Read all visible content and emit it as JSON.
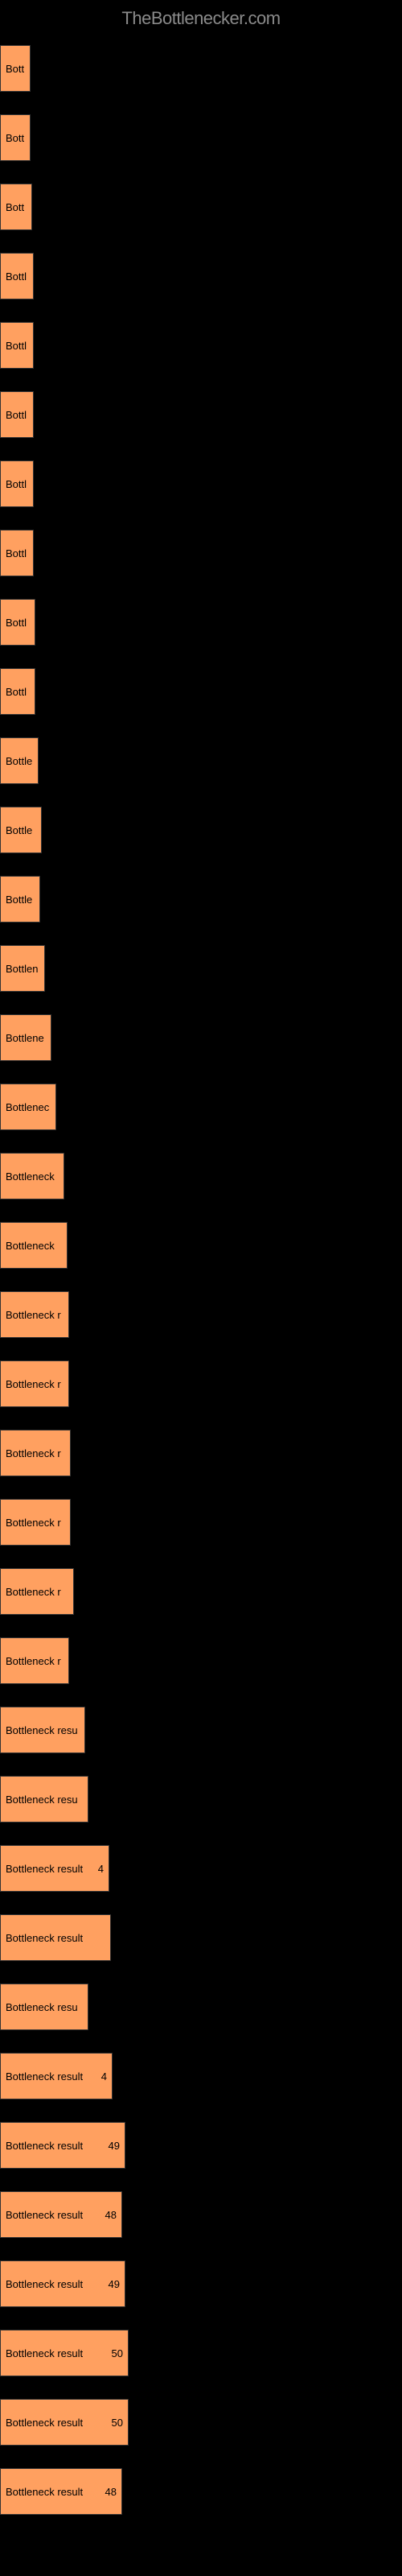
{
  "header": {
    "site_name": "TheBottlenecker.com"
  },
  "chart_data": {
    "type": "bar",
    "title": "",
    "xlabel": "",
    "ylabel": "",
    "max_width": 500,
    "bars": [
      {
        "label": "Bottleneck result",
        "width": 38,
        "value_shown": ""
      },
      {
        "label": "Bottleneck result",
        "width": 38,
        "value_shown": ""
      },
      {
        "label": "Bottleneck result",
        "width": 40,
        "value_shown": ""
      },
      {
        "label": "Bottleneck result",
        "width": 42,
        "value_shown": ""
      },
      {
        "label": "Bottleneck result",
        "width": 42,
        "value_shown": ""
      },
      {
        "label": "Bottleneck result",
        "width": 42,
        "value_shown": ""
      },
      {
        "label": "Bottleneck result",
        "width": 42,
        "value_shown": ""
      },
      {
        "label": "Bottleneck result",
        "width": 42,
        "value_shown": ""
      },
      {
        "label": "Bottleneck result",
        "width": 44,
        "value_shown": ""
      },
      {
        "label": "Bottleneck result",
        "width": 44,
        "value_shown": ""
      },
      {
        "label": "Bottleneck result",
        "width": 48,
        "value_shown": ""
      },
      {
        "label": "Bottleneck result",
        "width": 52,
        "value_shown": ""
      },
      {
        "label": "Bottleneck result",
        "width": 50,
        "value_shown": ""
      },
      {
        "label": "Bottleneck result",
        "width": 56,
        "value_shown": ""
      },
      {
        "label": "Bottleneck result",
        "width": 64,
        "value_shown": ""
      },
      {
        "label": "Bottleneck result",
        "width": 70,
        "value_shown": ""
      },
      {
        "label": "Bottleneck result",
        "width": 80,
        "value_shown": ""
      },
      {
        "label": "Bottleneck result",
        "width": 84,
        "value_shown": ""
      },
      {
        "label": "Bottleneck result",
        "width": 86,
        "value_shown": ""
      },
      {
        "label": "Bottleneck result",
        "width": 86,
        "value_shown": ""
      },
      {
        "label": "Bottleneck result",
        "width": 88,
        "value_shown": ""
      },
      {
        "label": "Bottleneck result",
        "width": 88,
        "value_shown": ""
      },
      {
        "label": "Bottleneck result",
        "width": 92,
        "value_shown": ""
      },
      {
        "label": "Bottleneck result",
        "width": 86,
        "value_shown": ""
      },
      {
        "label": "Bottleneck result",
        "width": 106,
        "value_shown": ""
      },
      {
        "label": "Bottleneck result",
        "width": 110,
        "value_shown": ""
      },
      {
        "label": "Bottleneck result",
        "width": 136,
        "value_shown": "4"
      },
      {
        "label": "Bottleneck result",
        "width": 138,
        "value_shown": ""
      },
      {
        "label": "Bottleneck result",
        "width": 110,
        "value_shown": ""
      },
      {
        "label": "Bottleneck result",
        "width": 140,
        "value_shown": "4"
      },
      {
        "label": "Bottleneck result",
        "width": 156,
        "value_shown": "49"
      },
      {
        "label": "Bottleneck result",
        "width": 152,
        "value_shown": "48"
      },
      {
        "label": "Bottleneck result",
        "width": 156,
        "value_shown": "49"
      },
      {
        "label": "Bottleneck result",
        "width": 160,
        "value_shown": "50"
      },
      {
        "label": "Bottleneck result",
        "width": 160,
        "value_shown": "50"
      },
      {
        "label": "Bottleneck result",
        "width": 152,
        "value_shown": "48"
      }
    ]
  }
}
